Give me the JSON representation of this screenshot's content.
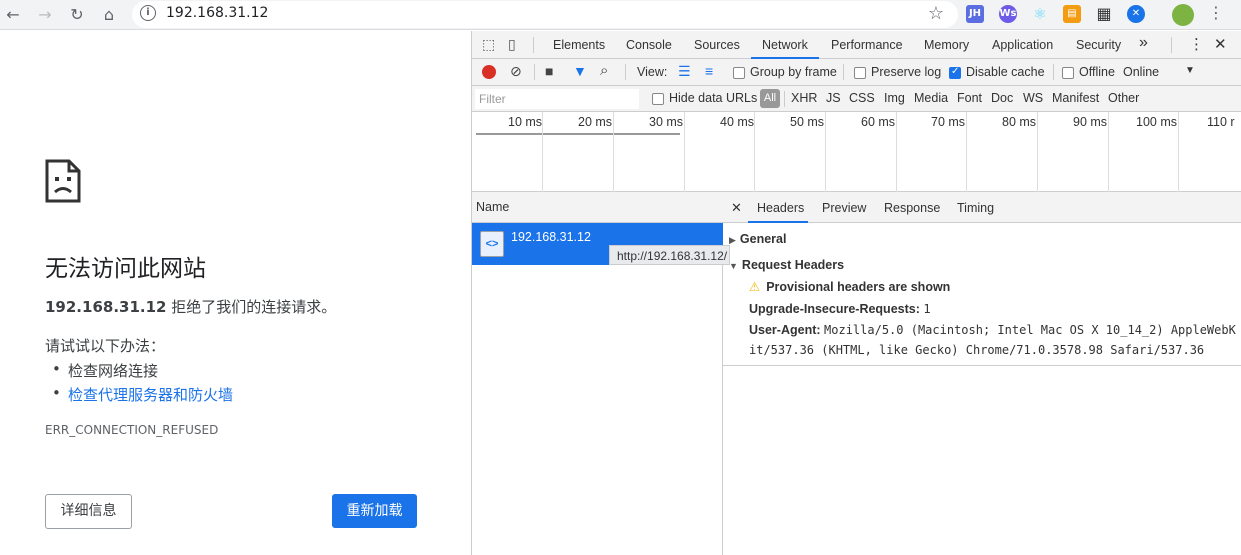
{
  "browser": {
    "url": "192.168.31.12",
    "extensions": [
      {
        "name": "jh-extension-icon",
        "label": "JH",
        "color": "#5b6ee1"
      },
      {
        "name": "ws-extension-icon",
        "label": "Ws",
        "color": "#6c5ce7"
      },
      {
        "name": "react-extension-icon",
        "label": "⚛",
        "color": "#61dafb"
      },
      {
        "name": "rss-extension-icon",
        "label": "▤",
        "color": "#f39c12"
      },
      {
        "name": "qr-extension-icon",
        "label": "▦",
        "color": "#333333"
      },
      {
        "name": "x-extension-icon",
        "label": "✕",
        "color": "#1a73e8"
      }
    ]
  },
  "error_page": {
    "title": "无法访问此网站",
    "host": "192.168.31.12",
    "message": " 拒绝了我们的连接请求。",
    "try_label": "请试试以下办法：",
    "suggestions": [
      "检查网络连接",
      "检查代理服务器和防火墙"
    ],
    "error_code": "ERR_CONNECTION_REFUSED",
    "details_button": "详细信息",
    "reload_button": "重新加载"
  },
  "devtools": {
    "tabs": [
      "Elements",
      "Console",
      "Sources",
      "Network",
      "Performance",
      "Memory",
      "Application",
      "Security"
    ],
    "active_tab": "Network",
    "more": "»",
    "toolbar": {
      "view_label": "View:",
      "group_by_frame": "Group by frame",
      "preserve_log": "Preserve log",
      "disable_cache": "Disable cache",
      "offline": "Offline",
      "throttling": "Online"
    },
    "filter": {
      "placeholder": "Filter",
      "hide_data_urls": "Hide data URLs",
      "all": "All",
      "types": [
        "XHR",
        "JS",
        "CSS",
        "Img",
        "Media",
        "Font",
        "Doc",
        "WS",
        "Manifest",
        "Other"
      ]
    },
    "timeline_ticks": [
      "10 ms",
      "20 ms",
      "30 ms",
      "40 ms",
      "50 ms",
      "60 ms",
      "70 ms",
      "80 ms",
      "90 ms",
      "100 ms",
      "110 r"
    ],
    "requests": {
      "column": "Name",
      "rows": [
        {
          "name": "192.168.31.12",
          "tooltip": "http://192.168.31.12/"
        }
      ]
    },
    "detail": {
      "tabs": [
        "Headers",
        "Preview",
        "Response",
        "Timing"
      ],
      "active_tab": "Headers",
      "general": "General",
      "request_headers": "Request Headers",
      "warning": "Provisional headers are shown",
      "headers": [
        {
          "key": "Upgrade-Insecure-Requests:",
          "value": "1"
        },
        {
          "key": "User-Agent:",
          "value": "Mozilla/5.0 (Macintosh; Intel Mac OS X 10_14_2) AppleWebK",
          "value2": "it/537.36 (KHTML, like Gecko) Chrome/71.0.3578.98 Safari/537.36"
        }
      ]
    }
  }
}
